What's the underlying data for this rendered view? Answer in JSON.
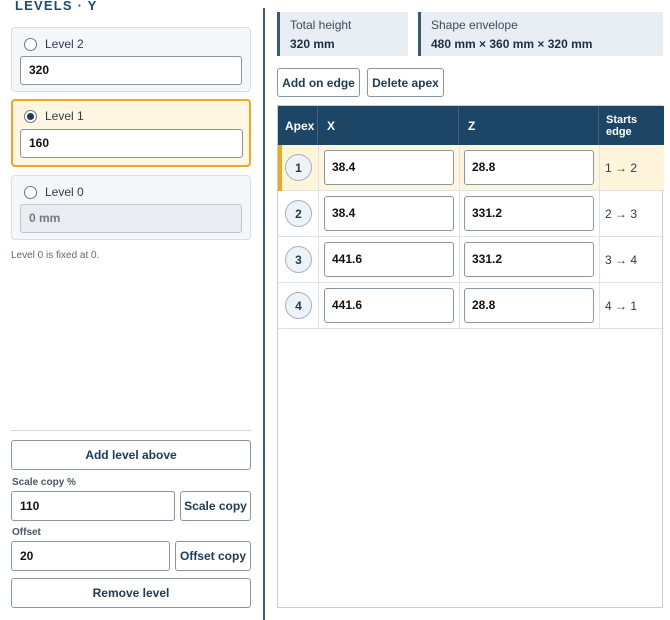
{
  "levels_panel": {
    "title": "LEVELS · Y",
    "levels": [
      {
        "label": "Level 2",
        "value": "320",
        "selected": false,
        "disabled": false
      },
      {
        "label": "Level 1",
        "value": "160",
        "selected": true,
        "disabled": false
      },
      {
        "label": "Level 0",
        "value": "0 mm",
        "selected": false,
        "disabled": true
      }
    ],
    "hint": "Level 0 is fixed at 0.",
    "add_level_above": "Add level above",
    "scale_copy_label": "Scale copy %",
    "scale_copy_value": "110",
    "scale_copy_button": "Scale copy",
    "offset_label": "Offset",
    "offset_value": "20",
    "offset_copy_button": "Offset copy",
    "remove_level": "Remove level"
  },
  "stats": {
    "total_height_label": "Total height",
    "total_height_value": "320 mm",
    "envelope_label": "Shape envelope",
    "envelope_value": "480 mm × 360 mm × 320 mm"
  },
  "toolbar": {
    "add_on_edge": "Add on edge",
    "delete_apex": "Delete apex"
  },
  "apex_table": {
    "headers": {
      "apex": "Apex",
      "x": "X",
      "z": "Z",
      "starts_edge": "Starts edge"
    },
    "rows": [
      {
        "apex": "1",
        "x": "38.4",
        "z": "28.8",
        "edge": "1 → 2",
        "selected": true
      },
      {
        "apex": "2",
        "x": "38.4",
        "z": "331.2",
        "edge": "2 → 3",
        "selected": false
      },
      {
        "apex": "3",
        "x": "441.6",
        "z": "331.2",
        "edge": "3 → 4",
        "selected": false
      },
      {
        "apex": "4",
        "x": "441.6",
        "z": "28.8",
        "edge": "4 → 1",
        "selected": false
      }
    ]
  },
  "colors": {
    "accent": "#f0a91e",
    "header": "#1d4566",
    "text_primary": "#1d3b55"
  }
}
